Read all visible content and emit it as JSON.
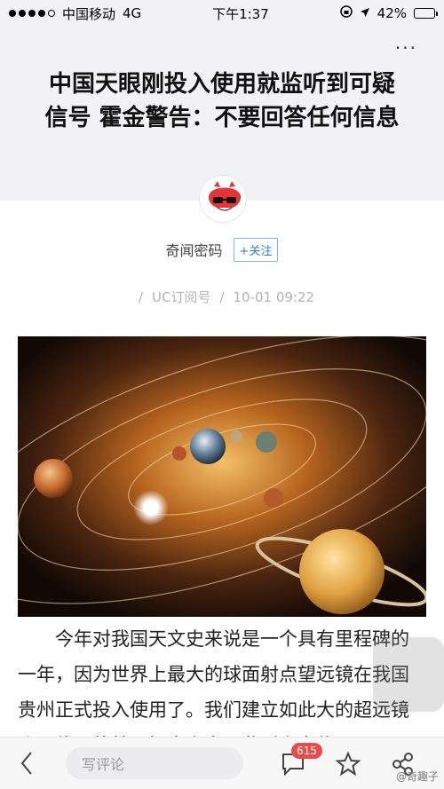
{
  "status_bar": {
    "carrier": "中国移动",
    "network": "4G",
    "time": "下午1:37",
    "battery": "42%",
    "battery_level": 0.42
  },
  "header": {
    "more_label": "···",
    "title": "中国天眼刚投入使用就监听到可疑信号 霍金警告：不要回答任何信息"
  },
  "author": {
    "name": "奇闻密码",
    "follow_label": "+关注"
  },
  "meta": {
    "source": "UC订阅号",
    "datetime": "10-01 09:22"
  },
  "article": {
    "paragraph": "　　今年对我国天文史来说是一个具有里程碑的一年，因为世界上最大的球面射点望远镜在我国贵州正式投入使用了。我们建立如此大的超远镜账，伟用的就是探索宇宙，监听宇宙信"
  },
  "bottom_bar": {
    "comment_placeholder": "写评论",
    "comment_count": "615"
  },
  "watermark": "@奇趣子",
  "colors": {
    "follow_blue": "#2c7ad6",
    "badge_red": "#e94b4b",
    "header_bg": "#f2f2f4"
  }
}
